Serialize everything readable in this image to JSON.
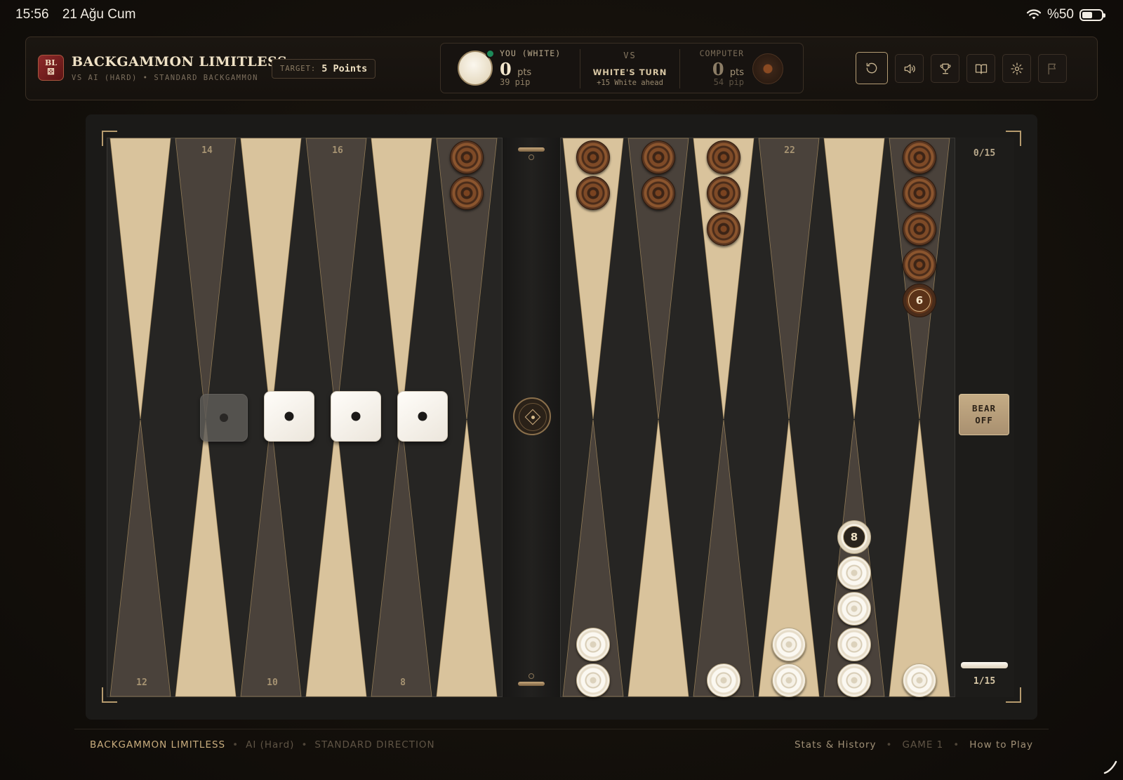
{
  "status_bar": {
    "time": "15:56",
    "date": "21 Ağu Cum",
    "battery": "%50"
  },
  "header": {
    "logo_text": "BL",
    "title": "BACKGAMMON LIMITLESS",
    "subtitle": "VS AI (HARD) • STANDARD BACKGAMMON",
    "target_label": "TARGET:",
    "target_value": "5 Points"
  },
  "scoreboard": {
    "player1": {
      "name": "YOU (WHITE)",
      "points": "0",
      "pts_unit": "pts",
      "pip": "39 pip"
    },
    "vs": "VS",
    "turn": "WHITE'S TURN",
    "lead": "+15 White ahead",
    "player2": {
      "name": "COMPUTER",
      "points": "0",
      "pts_unit": "pts",
      "pip": "54 pip"
    }
  },
  "toolbar": {
    "buttons": [
      {
        "name": "undo",
        "icon": "undo-icon"
      },
      {
        "name": "sound",
        "icon": "speaker-icon"
      },
      {
        "name": "trophy",
        "icon": "trophy-icon"
      },
      {
        "name": "rules",
        "icon": "book-icon"
      },
      {
        "name": "settings",
        "icon": "gear-icon"
      },
      {
        "name": "resign",
        "icon": "flag-icon"
      }
    ]
  },
  "board": {
    "point_labels_top": [
      "14",
      "16",
      "22"
    ],
    "point_labels_bottom": [
      "12",
      "10",
      "8"
    ],
    "borne_off_computer": "0/15",
    "borne_off_player": "1/15",
    "bear_off_button": "BEAR OFF",
    "stacks": [
      {
        "color": "brown",
        "column": 5,
        "side": "top",
        "count": 2,
        "label": ""
      },
      {
        "color": "brown",
        "column": 6,
        "side": "top",
        "count": 2,
        "label": ""
      },
      {
        "color": "brown",
        "column": 7,
        "side": "top",
        "count": 2,
        "label": ""
      },
      {
        "color": "brown",
        "column": 8,
        "side": "top",
        "count": 3,
        "label": ""
      },
      {
        "color": "brown",
        "column": 11,
        "side": "top",
        "count": 5,
        "label": "6"
      },
      {
        "color": "white",
        "column": 6,
        "side": "bottom",
        "count": 2,
        "label": ""
      },
      {
        "color": "white",
        "column": 8,
        "side": "bottom",
        "count": 1,
        "label": ""
      },
      {
        "color": "white",
        "column": 9,
        "side": "bottom",
        "count": 2,
        "label": ""
      },
      {
        "color": "white",
        "column": 10,
        "side": "bottom",
        "count": 5,
        "label": "8"
      },
      {
        "color": "white",
        "column": 11,
        "side": "bottom",
        "count": 1,
        "label": ""
      }
    ],
    "dice": [
      {
        "value": 1,
        "used": true
      },
      {
        "value": 1,
        "used": false
      },
      {
        "value": 1,
        "used": false
      },
      {
        "value": 1,
        "used": false
      }
    ]
  },
  "colors": {
    "light_point": "#d9c39c",
    "dark_point": "#4a423b",
    "gold_line": "#b89a66"
  },
  "footer": {
    "brand": "BACKGAMMON LIMITLESS",
    "mode": "AI (Hard)",
    "direction": "STANDARD DIRECTION",
    "stats": "Stats & History",
    "game": "GAME 1",
    "how_to": "How to Play"
  }
}
